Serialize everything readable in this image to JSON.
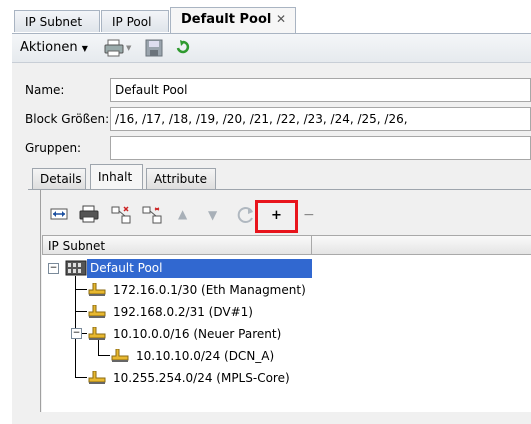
{
  "tabs": [
    {
      "label": "IP Subnet"
    },
    {
      "label": "IP Pool"
    },
    {
      "label": "Default Pool",
      "close": "✕"
    }
  ],
  "toolbar": {
    "actions_label": "Aktionen"
  },
  "form": {
    "name_label": "Name:",
    "name_value": "Default Pool",
    "block_label": "Block Größen:",
    "block_value": "/16, /17, /18, /19, /20, /21, /22, /23, /24, /25, /26,",
    "groups_label": "Gruppen:",
    "groups_value": ""
  },
  "inner_tabs": [
    {
      "label": "Details"
    },
    {
      "label": "Inhalt"
    },
    {
      "label": "Attribute"
    }
  ],
  "table": {
    "column_header": "IP Subnet"
  },
  "tree": {
    "root": "Default Pool",
    "items": [
      "172.16.0.1/30 (Eth Managment)",
      "192.168.0.2/31 (DV#1)",
      "10.10.0.0/16 (Neuer Parent)",
      "10.10.10.0/24 (DCN_A)",
      "10.255.254.0/24 (MPLS-Core)"
    ]
  },
  "colors": {
    "highlight_box": "#e8141c",
    "selection": "#3168d0"
  }
}
